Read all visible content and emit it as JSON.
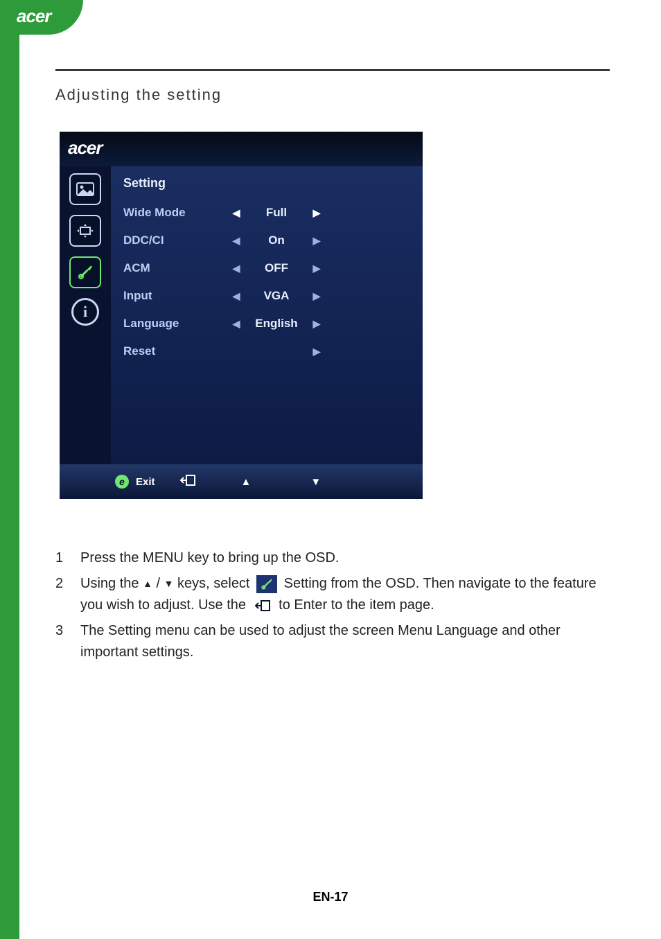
{
  "header_logo": "acer",
  "section_title": "Adjusting the setting",
  "osd": {
    "logo": "acer",
    "menu_title": "Setting",
    "rows": [
      {
        "label": "Wide Mode",
        "value": "Full",
        "left": true,
        "right": true
      },
      {
        "label": "DDC/CI",
        "value": "On",
        "left": true,
        "right": true
      },
      {
        "label": "ACM",
        "value": "OFF",
        "left": true,
        "right": true
      },
      {
        "label": "Input",
        "value": "VGA",
        "left": true,
        "right": true
      },
      {
        "label": "Language",
        "value": "English",
        "left": true,
        "right": true
      },
      {
        "label": "Reset",
        "value": "",
        "left": false,
        "right": true
      }
    ],
    "footer": {
      "exit": "Exit"
    }
  },
  "steps": {
    "s1": "Press the MENU key to bring up the OSD.",
    "s2a": "Using the ",
    "s2b": " / ",
    "s2c": " keys, select ",
    "s2d": " Setting from the OSD. Then navigate to the feature you wish to adjust. Use the ",
    "s2e": " to Enter to the item page.",
    "s3": "The Setting menu can be used to adjust the screen Menu Language and other important settings."
  },
  "page_number": "EN-17"
}
